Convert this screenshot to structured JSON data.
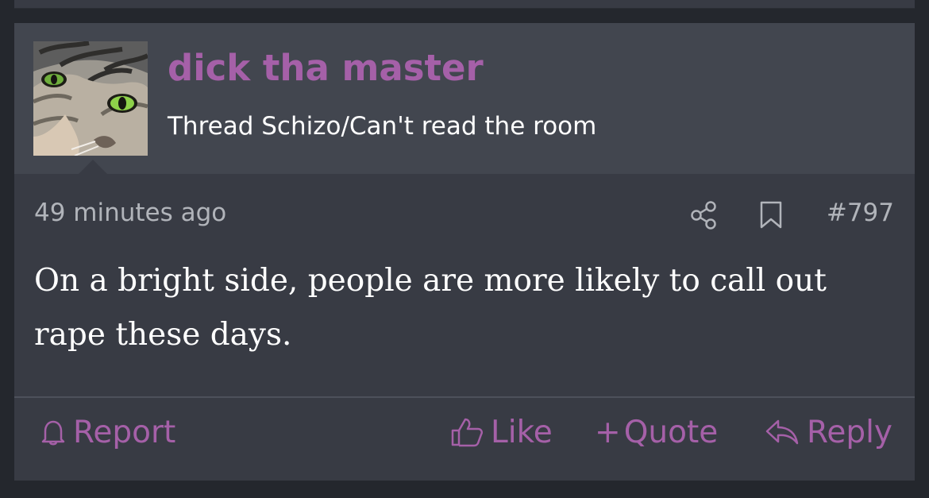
{
  "post": {
    "username": "dick tha master",
    "user_title": "Thread Schizo/Can't read the room",
    "timestamp": "49 minutes ago",
    "post_number": "#797",
    "message": "On a bright side, people are more likely to call out rape these days.",
    "avatar_description": "tabby-cat-avatar"
  },
  "actions": {
    "report": "Report",
    "like": "Like",
    "quote_plus": "+",
    "quote": "Quote",
    "reply": "Reply"
  },
  "icons": {
    "share": "share-icon",
    "bookmark": "bookmark-icon",
    "report": "bell-icon",
    "like": "thumbs-up-icon",
    "reply": "reply-arrow-icon"
  },
  "colors": {
    "page_background": "#24272d",
    "post_background": "#383b44",
    "header_background": "#42464f",
    "accent": "#a560a8",
    "muted_text": "#b1b4ba",
    "text": "#ffffff"
  }
}
